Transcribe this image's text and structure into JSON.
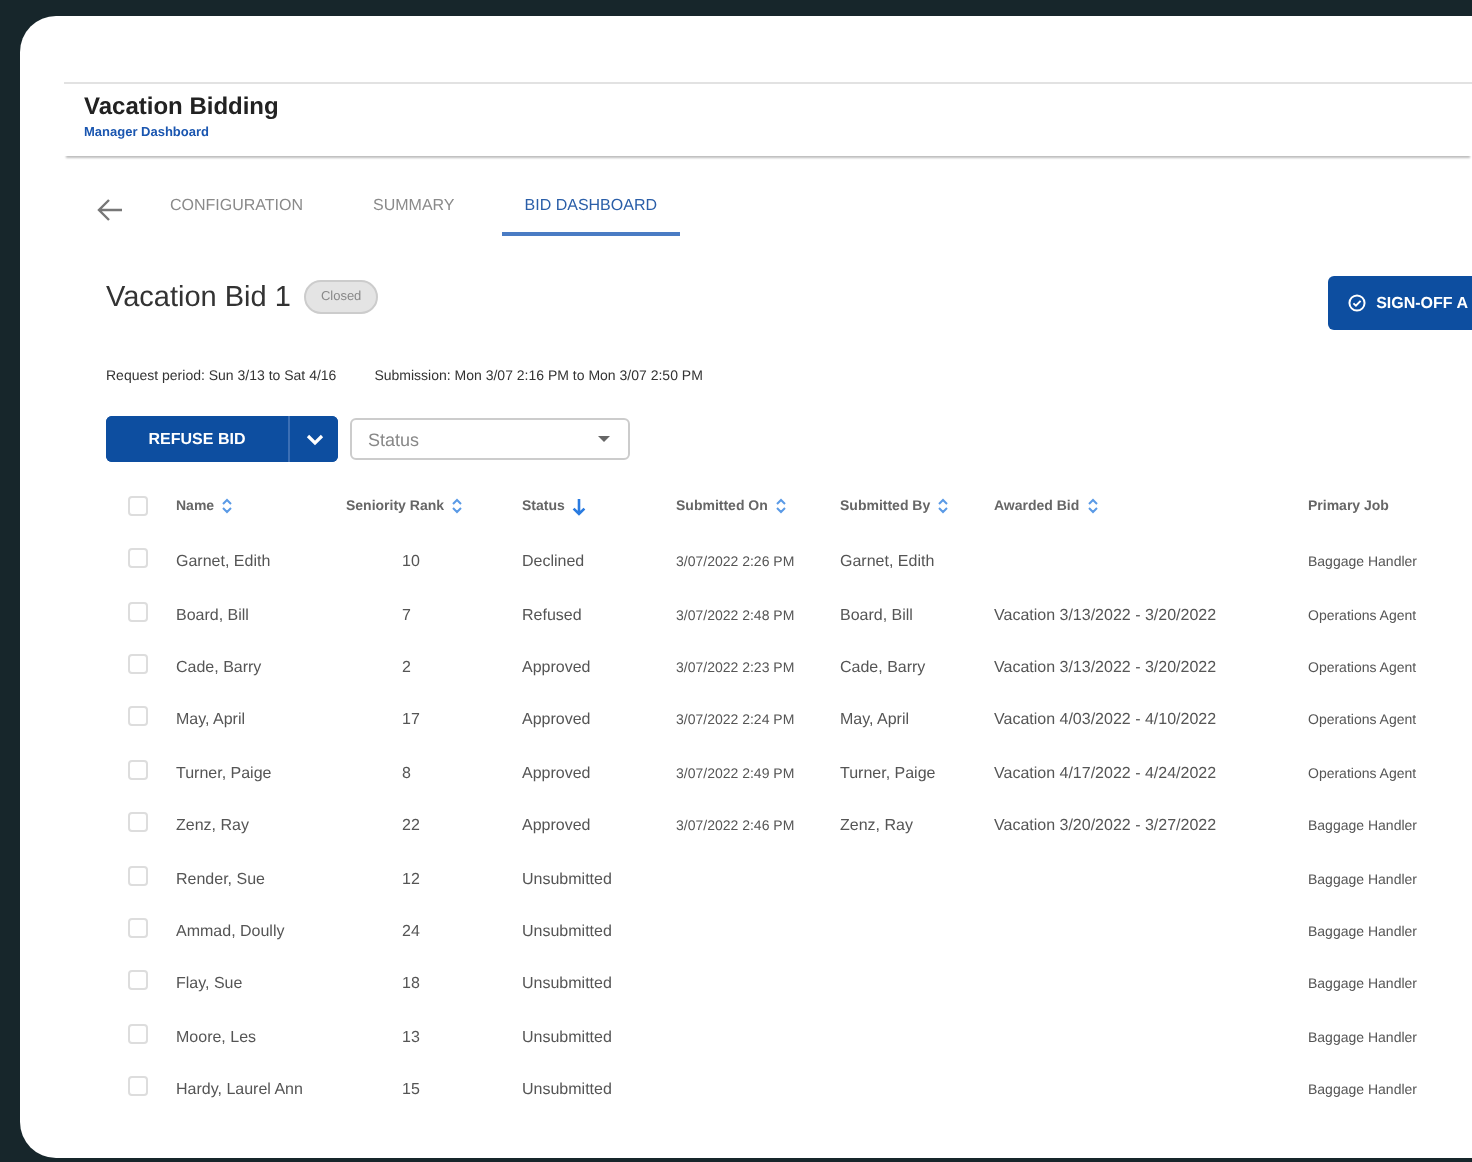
{
  "app": {
    "title": "Vacation Bidding",
    "subtitle": "Manager Dashboard"
  },
  "tabs": [
    {
      "label": "CONFIGURATION",
      "selected": false
    },
    {
      "label": "SUMMARY",
      "selected": false
    },
    {
      "label": "BID DASHBOARD",
      "selected": true
    }
  ],
  "bid": {
    "title": "Vacation Bid 1",
    "status_badge": "Closed",
    "sign_off_button": "SIGN-OFF A",
    "request_period": "Request period: Sun 3/13 to Sat  4/16",
    "submission": "Submission: Mon 3/07 2:16 PM to Mon 3/07 2:50 PM"
  },
  "actions": {
    "refuse_button": "REFUSE BID",
    "status_filter": {
      "placeholder": "Status"
    }
  },
  "table": {
    "header_checked": false,
    "columns": [
      {
        "label": "Name",
        "kind": "sortable"
      },
      {
        "label": "Seniority Rank",
        "kind": "sortable"
      },
      {
        "label": "Status",
        "kind": "sorted"
      },
      {
        "label": "Submitted On",
        "kind": "sortable"
      },
      {
        "label": "Submitted By",
        "kind": "sortable"
      },
      {
        "label": "Awarded Bid",
        "kind": "sortable"
      },
      {
        "label": "Primary Job",
        "kind": "plain"
      }
    ],
    "rows": [
      {
        "checked": false,
        "cells": [
          "Garnet, Edith",
          "10",
          "Declined",
          "3/07/2022 2:26 PM",
          "Garnet, Edith",
          "",
          "Baggage Handler"
        ]
      },
      {
        "checked": false,
        "cells": [
          "Board, Bill",
          "7",
          "Refused",
          "3/07/2022 2:48 PM",
          "Board, Bill",
          "Vacation 3/13/2022 - 3/20/2022",
          "Operations Agent"
        ]
      },
      {
        "checked": false,
        "cells": [
          "Cade, Barry",
          "2",
          "Approved",
          "3/07/2022 2:23 PM",
          "Cade, Barry",
          "Vacation 3/13/2022 - 3/20/2022",
          "Operations Agent"
        ]
      },
      {
        "checked": false,
        "cells": [
          "May, April",
          "17",
          "Approved",
          "3/07/2022 2:24 PM",
          "May, April",
          "Vacation 4/03/2022 - 4/10/2022",
          "Operations Agent"
        ]
      },
      {
        "checked": false,
        "cells": [
          "Turner, Paige",
          "8",
          "Approved",
          "3/07/2022 2:49 PM",
          "Turner, Paige",
          "Vacation 4/17/2022 - 4/24/2022",
          "Operations Agent"
        ]
      },
      {
        "checked": false,
        "cells": [
          "Zenz, Ray",
          "22",
          "Approved",
          "3/07/2022 2:46 PM",
          "Zenz, Ray",
          "Vacation 3/20/2022 - 3/27/2022",
          "Baggage Handler"
        ]
      },
      {
        "checked": false,
        "cells": [
          "Render, Sue",
          "12",
          "Unsubmitted",
          "",
          "",
          "",
          "Baggage Handler"
        ]
      },
      {
        "checked": false,
        "cells": [
          "Ammad, Doully",
          "24",
          "Unsubmitted",
          "",
          "",
          "",
          "Baggage Handler"
        ]
      },
      {
        "checked": false,
        "cells": [
          "Flay, Sue",
          "18",
          "Unsubmitted",
          "",
          "",
          "",
          "Baggage Handler"
        ]
      },
      {
        "checked": false,
        "cells": [
          "Moore, Les",
          "13",
          "Unsubmitted",
          "",
          "",
          "",
          "Baggage Handler"
        ]
      },
      {
        "checked": false,
        "cells": [
          "Hardy, Laurel Ann",
          "15",
          "Unsubmitted",
          "",
          "",
          "",
          "Baggage Handler"
        ]
      }
    ]
  }
}
